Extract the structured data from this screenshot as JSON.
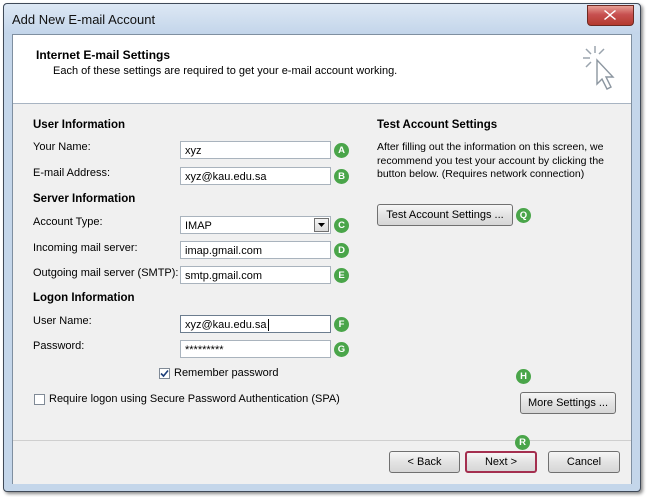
{
  "window": {
    "title": "Add New E-mail Account"
  },
  "header": {
    "title": "Internet E-mail Settings",
    "subtitle": "Each of these settings are required to get your e-mail account working."
  },
  "user_info": {
    "heading": "User Information",
    "name_label": "Your Name:",
    "name_value": "xyz",
    "email_label": "E-mail Address:",
    "email_value": "xyz@kau.edu.sa"
  },
  "server_info": {
    "heading": "Server Information",
    "account_type_label": "Account Type:",
    "account_type_value": "IMAP",
    "incoming_label": "Incoming mail server:",
    "incoming_value": "imap.gmail.com",
    "outgoing_label": "Outgoing mail server (SMTP):",
    "outgoing_value": "smtp.gmail.com"
  },
  "logon_info": {
    "heading": "Logon Information",
    "username_label": "User Name:",
    "username_value": "xyz@kau.edu.sa",
    "password_label": "Password:",
    "password_value": "*********",
    "remember_label": "Remember password",
    "remember_checked": true,
    "spa_label": "Require logon using Secure Password Authentication (SPA)",
    "spa_checked": false
  },
  "test_settings": {
    "heading": "Test Account Settings",
    "description_line1": "After filling out the information on this screen, we",
    "description_line2": "recommend you test your account by clicking the",
    "description_line3": "button below. (Requires network connection)",
    "button_label": "Test Account Settings ..."
  },
  "more_settings_label": "More Settings ...",
  "footer": {
    "back_label": "< Back",
    "next_label": "Next >",
    "cancel_label": "Cancel"
  },
  "badges": {
    "a": "A",
    "b": "B",
    "c": "C",
    "d": "D",
    "e": "E",
    "f": "F",
    "g": "G",
    "h": "H",
    "q": "Q",
    "r": "R"
  },
  "colors": {
    "badge": "#4aa54a",
    "focus_border": "#a42f4f",
    "dialog_frame": "#c4d6ea"
  }
}
